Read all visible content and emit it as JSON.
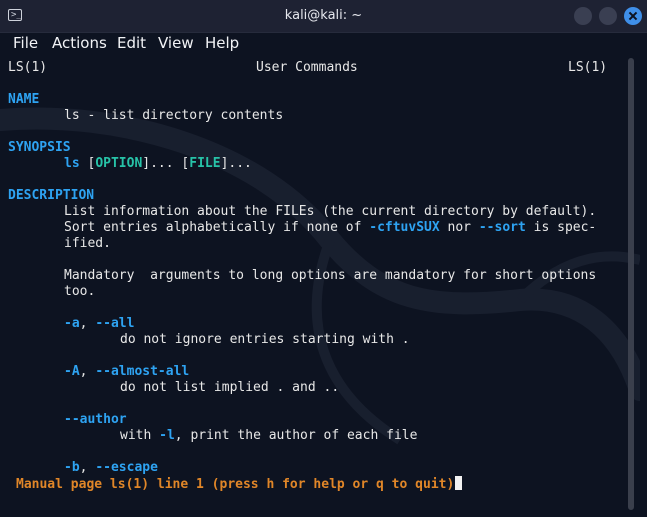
{
  "window": {
    "title": "kali@kali: ~"
  },
  "menu": [
    "File",
    "Actions",
    "Edit",
    "View",
    "Help"
  ],
  "man": {
    "header_left": "LS(1)",
    "header_center": "User Commands",
    "header_right": "LS(1)",
    "name_heading": "NAME",
    "name_text": "ls - list directory contents",
    "synopsis_heading": "SYNOPSIS",
    "synopsis_cmd": "ls",
    "synopsis_open1": " [",
    "synopsis_option": "OPTION",
    "synopsis_close1": "]... ",
    "synopsis_open2": "[",
    "synopsis_file": "FILE",
    "synopsis_close2": "]...",
    "description_heading": "DESCRIPTION",
    "desc_line1": "List information about the FILEs (the current directory by default).",
    "desc_line2_a": "Sort entries alphabetically if none of ",
    "desc_line2_b": "-cftuvSUX",
    "desc_line2_c": " nor ",
    "desc_line2_d": "--sort",
    "desc_line2_e": " is spec-",
    "desc_line3": "ified.",
    "desc_line4": "Mandatory  arguments to long options are mandatory for short options",
    "desc_line5": "too.",
    "opt_a_short": "-a",
    "opt_a_sep": ", ",
    "opt_a_long": "--all",
    "opt_a_desc": "do not ignore entries starting with .",
    "opt_A_short": "-A",
    "opt_A_sep": ", ",
    "opt_A_long": "--almost-all",
    "opt_A_desc": "do not list implied . and ..",
    "opt_author_long": "--author",
    "opt_author_desc_a": "with ",
    "opt_author_desc_b": "-l",
    "opt_author_desc_c": ", print the author of each file",
    "opt_b_short": "-b",
    "opt_b_sep": ", ",
    "opt_b_long": "--escape"
  },
  "status": "Manual page ls(1) line 1 (press h for help or q to quit)",
  "colors": {
    "accent": "#2ea3f2",
    "teal": "#27c3a8",
    "status": "#e08628",
    "close_button": "#3f8fe8"
  }
}
